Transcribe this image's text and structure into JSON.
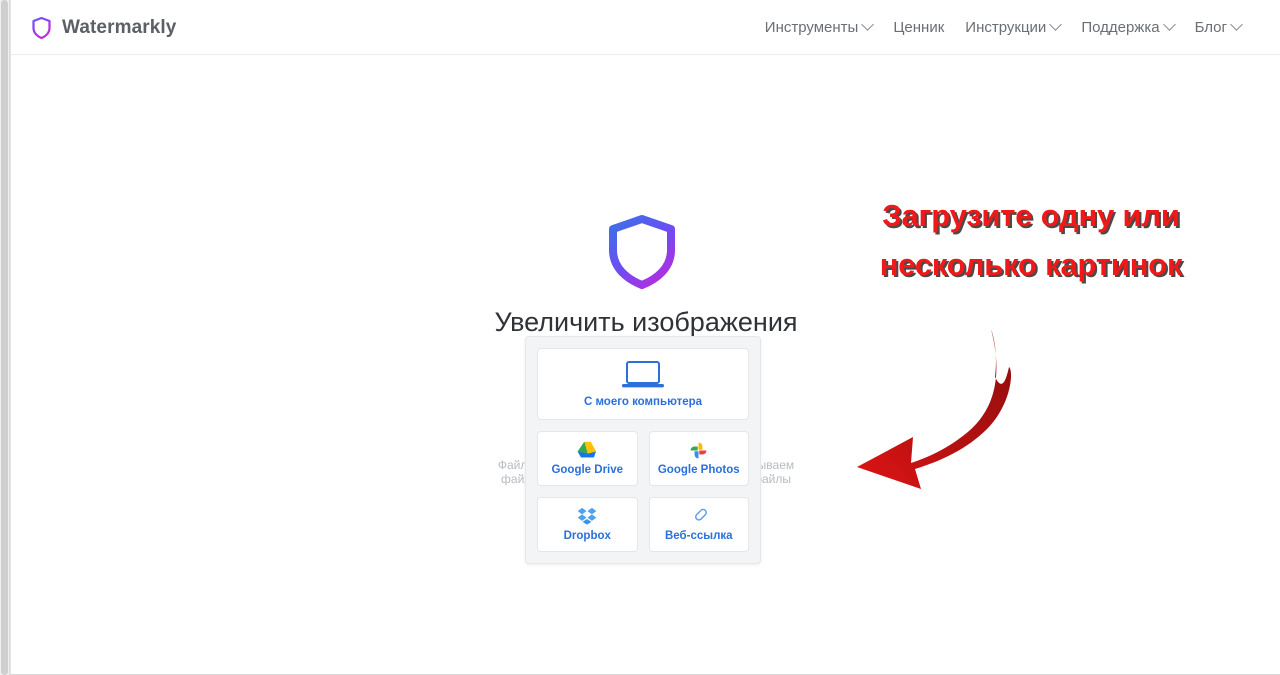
{
  "header": {
    "brand": {
      "name": "Watermarkly",
      "logo_icon": "shield-icon"
    },
    "nav": [
      {
        "label": "Инструменты",
        "has_dropdown": true
      },
      {
        "label": "Ценник",
        "has_dropdown": false
      },
      {
        "label": "Инструкции",
        "has_dropdown": true
      },
      {
        "label": "Поддержка",
        "has_dropdown": true
      },
      {
        "label": "Блог",
        "has_dropdown": true
      }
    ]
  },
  "hero": {
    "logo_icon": "shield-icon",
    "title": "Увеличить изображения",
    "note_line1": "Файлы не загружаются на сервер, мы обрабатываем",
    "note_line2": "файлы в вашем браузере и не храним ваши файлы"
  },
  "upload_panel": {
    "primary": {
      "label": "С моего компьютера",
      "icon": "laptop-icon"
    },
    "sources": [
      {
        "label": "Google Drive",
        "icon": "google-drive-icon"
      },
      {
        "label": "Google Photos",
        "icon": "google-photos-icon"
      },
      {
        "label": "Dropbox",
        "icon": "dropbox-icon"
      },
      {
        "label": "Веб-ссылка",
        "icon": "link-icon"
      }
    ]
  },
  "annotation": {
    "text": "Загрузите одну или несколько картинок",
    "color": "#f01818",
    "arrow_icon": "curved-arrow-down-left-icon",
    "arrow_color": "#b51111"
  },
  "colors": {
    "accent_blue": "#2a6fdb",
    "brand_purple": "#8b3ff0",
    "panel_bg": "#f3f4f6",
    "text_dark": "#2f3338",
    "text_muted": "#6a6f75"
  }
}
